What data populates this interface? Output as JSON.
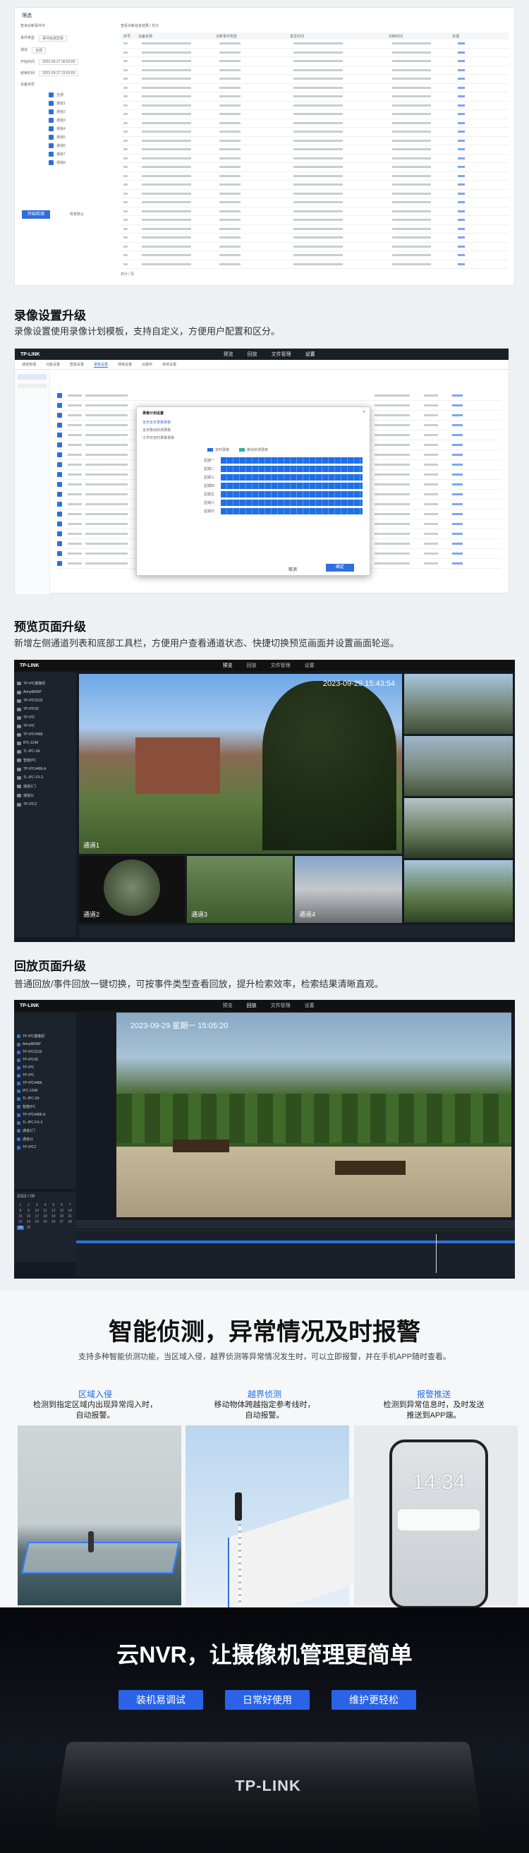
{
  "section0": {
    "panel_tab": "筛选",
    "left_labels": [
      "查询诊断事件中",
      "事件类型",
      "通道",
      "开始时间",
      "结束时间",
      "设备状态",
      "全部设备",
      "已选",
      "搜索"
    ],
    "left_values": [
      "事件检测异常",
      "全部",
      "2022-09-27 00:00:00",
      "2022-09-27 23:59:59"
    ],
    "checkbox_items": [
      "全部",
      "通道1",
      "通道2",
      "通道3",
      "通道4",
      "通道5",
      "通道6",
      "通道7",
      "通道8"
    ],
    "search_btn": "开始检测",
    "reset_btn": "恢复默认",
    "table_caption": "查看诊断信息结果 / 共计",
    "table_headers": [
      "序号",
      "设备名称",
      "诊断事件类型",
      "发生时间",
      "诊断时间",
      "处理"
    ],
    "row_count": 26,
    "pager": "共计 / 页"
  },
  "section1": {
    "title": "录像设置升级",
    "desc": "录像设置使用录像计划模板，支持自定义，方便用户配置和区分。",
    "app_nav": [
      "预览",
      "回放",
      "文件管理",
      "设置"
    ],
    "app_tabs": [
      "通道管理",
      "功能设置",
      "智能设置",
      "录像设置",
      "网络设置",
      "云服务",
      "系统设置"
    ],
    "modal_title": "录像计划设置",
    "modal_options": [
      "全天全天录像录像",
      "全天移动侦测录像",
      "工作日定时录像录像"
    ],
    "legend": [
      "定时录像",
      "移动侦测录像"
    ],
    "days": [
      "星期一",
      "星期二",
      "星期三",
      "星期四",
      "星期五",
      "星期六",
      "星期日"
    ],
    "modal_cancel": "取消",
    "modal_ok": "确定",
    "channel_rows": 18
  },
  "section2": {
    "title": "预览页面升级",
    "desc": "新增左侧通道列表和底部工具栏，方便用户查看通道状态、快捷切换预览画面并设置画面轮巡。",
    "timestamp_main": "2023-09-29 15:43:54",
    "tiles": [
      "通道1",
      "通道2",
      "通道3",
      "通道4"
    ],
    "channel_list": [
      "TP-IPC摄像机",
      "Anny8806P",
      "TP-IPC3102",
      "TP-IPC42",
      "TP-IPC",
      "TP-IPC",
      "TP-IPC4486",
      "IPC-1248",
      "TL-IPC-2A",
      "智能IPC",
      "TP-IPC4486-A",
      "TL-IPC-FX-2",
      "通道1门",
      "通道11",
      "TP-IPC2"
    ]
  },
  "section3": {
    "title": "回放页面升级",
    "desc": "普通回放/事件回放一键切换，可按事件类型查看回放，提升检索效率，检索结果清晰直观。",
    "timestamp": "2023-09-29 星期一 15:05:20",
    "month_label": "2023 / 09"
  },
  "section4": {
    "headline": "智能侦测，异常情况及时报警",
    "subtitle": "支持多种智能侦测功能，当区域入侵，越界侦测等异常情况发生时，可以立即报警，并在手机APP随时查看。",
    "features": [
      {
        "title": "区域入侵",
        "desc1": "检测到指定区域内出现异常闯入时，",
        "desc2": "自动报警。"
      },
      {
        "title": "越界侦测",
        "desc1": "移动物体跨越指定参考线时，",
        "desc2": "自动报警。"
      },
      {
        "title": "报警推送",
        "desc1": "检测到异常信息时，及时发送",
        "desc2": "推送到APP端。"
      }
    ],
    "phone_time": "14:34"
  },
  "section5": {
    "headline": "云NVR，让摄像机管理更简单",
    "buttons": [
      "装机易调试",
      "日常好使用",
      "维护更轻松"
    ],
    "brand": "TP-LINK"
  },
  "colors": {
    "accent": "#2a63e6",
    "dark_bg": "#151a22",
    "cta_blue": "#2a63e6"
  }
}
